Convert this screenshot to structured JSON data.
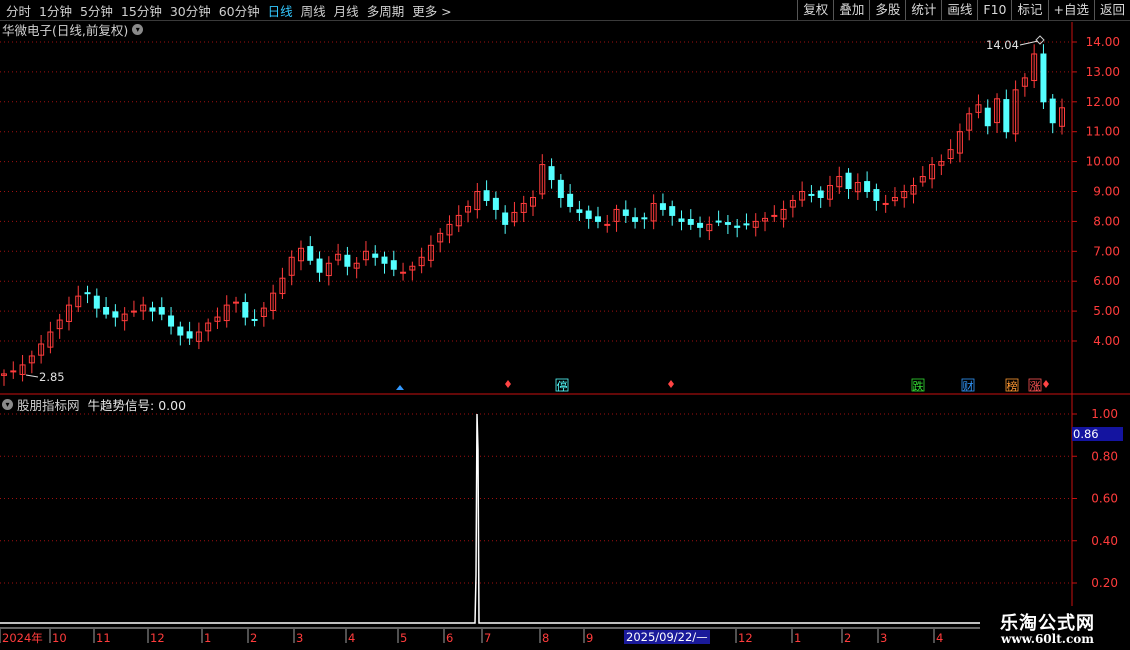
{
  "toolbar": {
    "periods": [
      "分时",
      "1分钟",
      "5分钟",
      "15分钟",
      "30分钟",
      "60分钟",
      "日线",
      "周线",
      "月线",
      "多周期",
      "更多 >"
    ],
    "active_period": "日线",
    "tools": [
      "复权",
      "叠加",
      "多股",
      "统计",
      "画线",
      "F10",
      "标记",
      "+自选",
      "返回"
    ]
  },
  "main_chart": {
    "title": "华微电子(日线,前复权)",
    "high_label": "14.04",
    "low_label": "2.85",
    "y_ticks": [
      "14.00",
      "13.00",
      "12.00",
      "11.00",
      "10.00",
      "9.00",
      "8.00",
      "7.00",
      "6.00",
      "5.00",
      "4.00"
    ],
    "markers": [
      "停",
      "跌",
      "财",
      "榜",
      "涨"
    ]
  },
  "indicator": {
    "name": "股朋指标网",
    "signal_label": "牛趋势信号: 0.00",
    "current_value": "0.86",
    "y_ticks": [
      "1.00",
      "0.80",
      "0.60",
      "0.40",
      "0.20"
    ]
  },
  "x_axis": {
    "labels": [
      "2024年",
      "10",
      "11",
      "12",
      "1",
      "2",
      "3",
      "4",
      "5",
      "6",
      "7",
      "8",
      "9",
      "12",
      "1",
      "2",
      "3",
      "4"
    ],
    "cursor_date": "2025/09/22/—"
  },
  "watermark": {
    "line1": "乐淘公式网",
    "line2": "www.60lt.com"
  },
  "colors": {
    "up": "#ff3c3c",
    "down": "#54ffff",
    "grid": "#a01010",
    "axis": "#c81010",
    "signal": "#ffffff"
  },
  "chart_data": {
    "type": "candlestick",
    "series": [
      {
        "name": "华微电子",
        "close": [
          2.9,
          3.0,
          3.2,
          3.5,
          3.9,
          4.3,
          4.7,
          5.2,
          5.5,
          5.6,
          5.1,
          4.9,
          4.8,
          4.9,
          5.0,
          5.2,
          5.0,
          4.9,
          4.5,
          4.2,
          4.1,
          4.3,
          4.6,
          4.8,
          5.2,
          5.3,
          4.8,
          4.7,
          5.1,
          5.6,
          6.1,
          6.8,
          7.1,
          6.7,
          6.3,
          6.6,
          6.9,
          6.5,
          6.6,
          7.0,
          6.8,
          6.6,
          6.4,
          6.3,
          6.5,
          6.8,
          7.2,
          7.6,
          7.9,
          8.2,
          8.5,
          9.0,
          8.7,
          8.4,
          7.9,
          8.3,
          8.6,
          8.8,
          9.9,
          9.4,
          8.8,
          8.5,
          8.3,
          8.1,
          8.0,
          7.9,
          8.4,
          8.2,
          8.0,
          8.1,
          8.6,
          8.4,
          8.2,
          8.0,
          7.9,
          7.8,
          7.9,
          8.0,
          7.9,
          7.8,
          7.9,
          8.0,
          8.1,
          8.2,
          8.4,
          8.7,
          9.0,
          8.9,
          8.8,
          9.2,
          9.5,
          9.1,
          9.3,
          9.0,
          8.7,
          8.6,
          8.8,
          9.0,
          9.2,
          9.5,
          9.9,
          10.0,
          10.4,
          11.0,
          11.6,
          11.9,
          11.2,
          12.1,
          11.0,
          12.4,
          12.8,
          13.6,
          12.0,
          11.3,
          11.8
        ]
      }
    ],
    "ylim": [
      2.85,
      14.04
    ],
    "signal": {
      "name": "牛趋势信号",
      "values": [
        0,
        1.0,
        0
      ],
      "ylim": [
        0,
        1.0
      ]
    }
  }
}
